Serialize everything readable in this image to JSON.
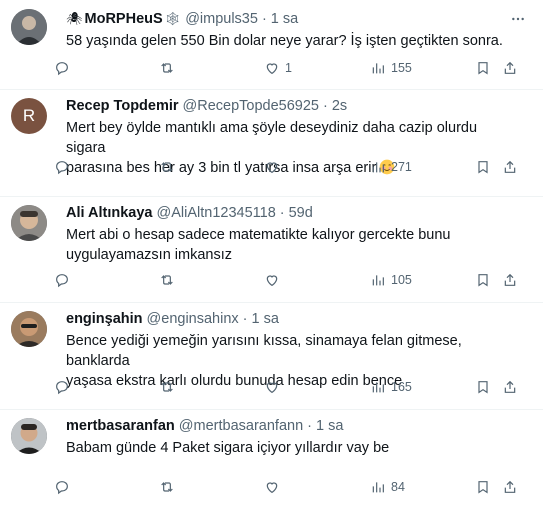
{
  "tweets": [
    {
      "name": "MoRPHeuS",
      "name_prefix_icon": "spider-icon",
      "name_suffix_icon": "spiderweb-icon",
      "handle": "@impuls35",
      "time": "1 sa",
      "text": "58 yaşında gelen 550 Bin dolar neye yarar? İş işten geçtikten sonra.",
      "avatar": "photo",
      "replies": "",
      "retweets": "",
      "likes": "1",
      "views": "155"
    },
    {
      "name": "Recep Topdemir",
      "handle": "@RecepTopde56925",
      "time": "2s",
      "text": "Mert bey öylde mantıklı ama şöyle deseydiniz daha cazip olurdu sigara\nparasına bes her ay 3 bin tl yatırsa insa arşa erir",
      "text_emoji": "smiling-face-emoji",
      "avatar": "letter",
      "avatar_letter": "R",
      "replies": "",
      "retweets": "",
      "likes": "",
      "views": "271"
    },
    {
      "name": "Ali Altınkaya",
      "handle": "@AliAltn12345118",
      "time": "59d",
      "text": "Mert abi o hesap sadece matematikte kalıyor gercekte bunu\nuygulayamazsın imkansız",
      "avatar": "photo",
      "replies": "",
      "retweets": "",
      "likes": "",
      "views": "105"
    },
    {
      "name": "enginşahin",
      "handle": "@enginsahinx",
      "time": "1 sa",
      "text": "Bence yediği yemeğin yarısını kıssa, sinamaya felan gitmese, banklarda\nyaşasa ekstra karlı olurdu bunuda hesap edin bence",
      "avatar": "photo",
      "replies": "",
      "retweets": "",
      "likes": "",
      "views": "165"
    },
    {
      "name": "mertbasaranfan",
      "handle": "@mertbasaranfann",
      "time": "1 sa",
      "text": "Babam günde 4 Paket sigara içiyor yıllardır vay be",
      "avatar": "photo",
      "replies": "",
      "retweets": "",
      "likes": "",
      "views": "84"
    }
  ],
  "meta": {
    "dot": "·",
    "colors": {
      "text": "#0f1419",
      "muted": "#536471",
      "divider": "#eff3f4"
    }
  }
}
